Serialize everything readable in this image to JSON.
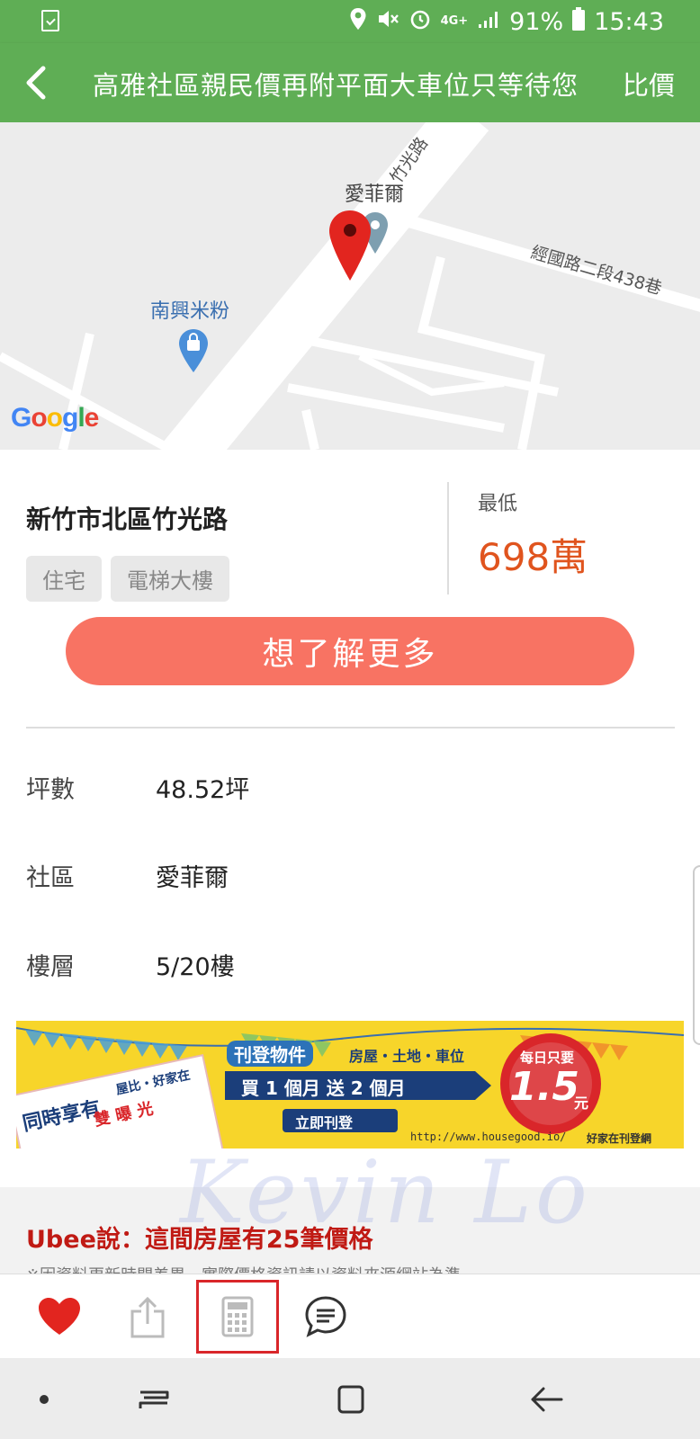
{
  "status_bar": {
    "battery": "91%",
    "time": "15:43",
    "network": "4G+"
  },
  "app_bar": {
    "title": "高雅社區親民價再附平面大車位只等待您",
    "compare_label": "比價"
  },
  "map": {
    "road_1": "竹光路",
    "road_2": "經國路二段438巷",
    "poi_1": "愛菲爾",
    "poi_2": "南興米粉",
    "logo": "Google"
  },
  "listing": {
    "address": "新竹市北區竹光路",
    "tags": [
      "住宅",
      "電梯大樓"
    ],
    "price_label": "最低",
    "price": "698萬",
    "cta_label": "想了解更多"
  },
  "details": [
    {
      "key": "坪數",
      "value": "48.52坪"
    },
    {
      "key": "社區",
      "value": "愛菲爾"
    },
    {
      "key": "樓層",
      "value": "5/20樓"
    }
  ],
  "banner": {
    "line_1": "刊登物件",
    "line_1b": "房屋・土地・車位",
    "line_2": "買 1 個月 送 2 個月",
    "button": "立即刊登",
    "badge_top": "每日只要",
    "badge_price": "1.5",
    "badge_unit": "元",
    "left_text": "同時享有",
    "left_small": "屋比・好家在",
    "stamp": "雙 曝 光",
    "url": "http://www.housegood.io/",
    "brand": "好家在刊登網"
  },
  "watermark": "Kevin Lo",
  "ubee": {
    "title": "Ubee說：這間房屋有25筆價格",
    "subtitle": "※因資料更新時間差異，實際價格資訊請以資料來源網站為準"
  },
  "colors": {
    "brand_green": "#5fae55",
    "price_orange": "#e0541e",
    "cta_coral": "#f87363",
    "ubee_red": "#c01a14"
  }
}
